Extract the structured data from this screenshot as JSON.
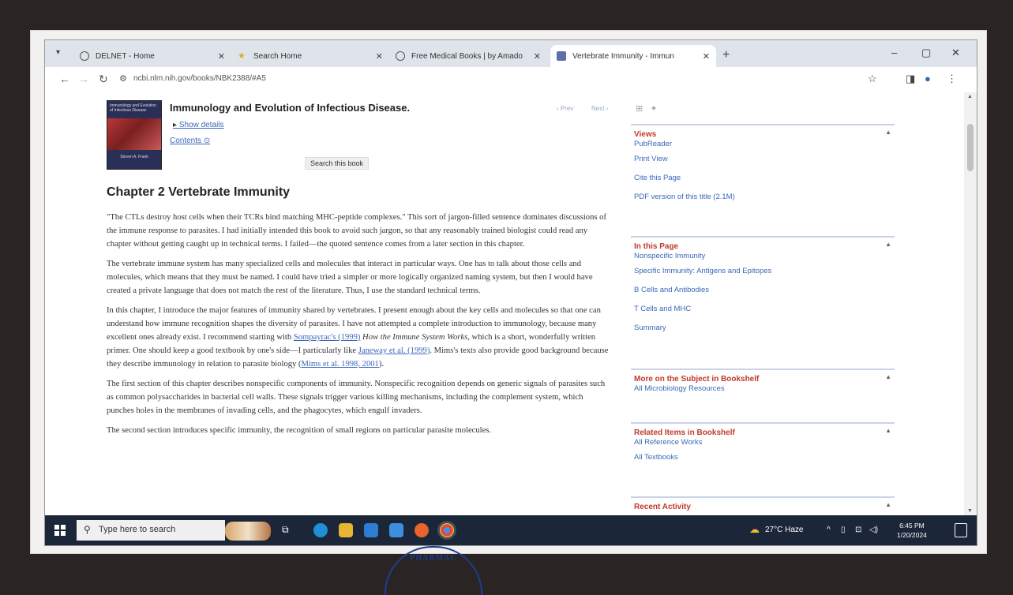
{
  "browser": {
    "tabs": [
      {
        "label": "DELNET - Home",
        "active": false
      },
      {
        "label": "Search Home",
        "active": false
      },
      {
        "label": "Free Medical Books | by Amado",
        "active": false
      },
      {
        "label": "Vertebrate Immunity - Immun",
        "active": true
      }
    ],
    "new_tab": "+",
    "url": "ncbi.nlm.nih.gov/books/NBK2388/#A5",
    "minimize": "–",
    "maximize": "▢",
    "close": "✕"
  },
  "book": {
    "title": "Immunology and Evolution of Infectious Disease.",
    "show_details": "Show details",
    "contents": "Contents",
    "search_button": "Search this book",
    "prev": "‹ Prev",
    "next": "Next ›",
    "cover_top": "Immunology and Evolution of Infectious Disease",
    "cover_author": "Steven A. Frank"
  },
  "chapter": {
    "heading": "Chapter 2   Vertebrate Immunity",
    "p1": "\"The CTLs destroy host cells when their TCRs bind matching MHC-peptide complexes.\" This sort of jargon-filled sentence dominates discussions of the immune response to parasites. I had initially intended this book to avoid such jargon, so that any reasonably trained biologist could read any chapter without getting caught up in technical terms. I failed—the quoted sentence comes from a later section in this chapter.",
    "p2": "The vertebrate immune system has many specialized cells and molecules that interact in particular ways. One has to talk about those cells and molecules, which means that they must be named. I could have tried a simpler or more logically organized naming system, but then I would have created a private language that does not match the rest of the literature. Thus, I use the standard technical terms.",
    "p3a": "In this chapter, I introduce the major features of immunity shared by vertebrates. I present enough about the key cells and molecules so that one can understand how immune recognition shapes the diversity of parasites. I have not attempted a complete introduction to immunology, because many excellent ones already exist. I recommend starting with ",
    "p3_link1": "Sompayrac's (1999)",
    "p3_book": " How the Immune System Works",
    "p3b": ", which is a short, wonderfully written primer. One should keep a good textbook by one's side—I particularly like ",
    "p3_link2": "Janeway et al. (1999)",
    "p3c": ". Mims's texts also provide good background because they describe immunology in relation to parasite biology (",
    "p3_link3": "Mims et al. 1998, 2001",
    "p3d": ").",
    "p4": "The first section of this chapter describes nonspecific components of immunity. Nonspecific recognition depends on generic signals of parasites such as common polysaccharides in bacterial cell walls. These signals trigger various killing mechanisms, including the complement system, which punches holes in the membranes of invading cells, and the phagocytes, which engulf invaders.",
    "p5": "The second section introduces specific immunity, the recognition of small regions on particular parasite molecules."
  },
  "sidebar": {
    "views": {
      "title": "Views",
      "links": [
        "PubReader",
        "Print View",
        "Cite this Page",
        "PDF version of this title (2.1M)"
      ]
    },
    "in_this_page": {
      "title": "In this Page",
      "links": [
        "Nonspecific Immunity",
        "Specific Immunity: Antigens and Epitopes",
        "B Cells and Antibodies",
        "T Cells and MHC",
        "Summary"
      ]
    },
    "more_subject": {
      "title": "More on the Subject in Bookshelf",
      "links": [
        "All Microbiology Resources"
      ]
    },
    "related": {
      "title": "Related Items in Bookshelf",
      "links": [
        "All Reference Works",
        "All Textbooks"
      ]
    },
    "recent": {
      "title": "Recent Activity"
    }
  },
  "taskbar": {
    "search_placeholder": "Type here to search",
    "weather": "27°C  Haze",
    "time": "6:45 PM",
    "date": "1/20/2024"
  },
  "stamp_text": "PHARMAC"
}
